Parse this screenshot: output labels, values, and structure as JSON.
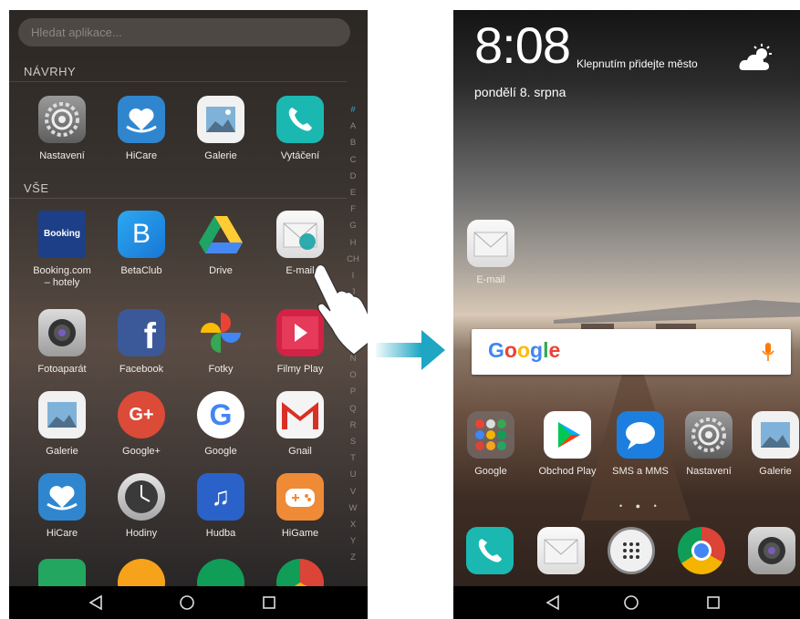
{
  "left_screen": {
    "search_placeholder": "Hledat aplikace...",
    "sections": {
      "suggestions": "NÁVRHY",
      "all": "VŠE"
    },
    "suggested_apps": [
      {
        "label": "Nastavení",
        "icon": "settings-icon"
      },
      {
        "label": "HiCare",
        "icon": "hicare-icon"
      },
      {
        "label": "Galerie",
        "icon": "gallery-icon"
      },
      {
        "label": "Vytáčení",
        "icon": "phone-icon"
      }
    ],
    "all_apps": [
      {
        "label": "Booking.com – hotely",
        "icon": "booking-icon",
        "icon_text": "Booking"
      },
      {
        "label": "BetaClub",
        "icon": "betaclub-icon",
        "icon_text": "B"
      },
      {
        "label": "Drive",
        "icon": "drive-icon"
      },
      {
        "label": "E-mail",
        "icon": "email-icon"
      },
      {
        "label": "Fotoaparát",
        "icon": "camera-icon"
      },
      {
        "label": "Facebook",
        "icon": "facebook-icon",
        "icon_text": "f"
      },
      {
        "label": "Fotky",
        "icon": "photos-icon"
      },
      {
        "label": "Filmy Play",
        "icon": "play-movies-icon"
      },
      {
        "label": "Galerie",
        "icon": "gallery-icon"
      },
      {
        "label": "Google+",
        "icon": "googleplus-icon",
        "icon_text": "G+"
      },
      {
        "label": "Google",
        "icon": "google-icon",
        "icon_text": "G"
      },
      {
        "label": "Gnail",
        "icon": "gmail-icon",
        "icon_text": "M"
      },
      {
        "label": "HiCare",
        "icon": "hicare-icon"
      },
      {
        "label": "Hodiny",
        "icon": "clock-icon"
      },
      {
        "label": "Hudba",
        "icon": "music-icon",
        "icon_text": "♫"
      },
      {
        "label": "HiGame",
        "icon": "game-icon"
      }
    ],
    "partial_row_icons": [
      "play-games-icon",
      "play-music-icon",
      "hangouts-icon",
      "chrome-icon"
    ],
    "alphabet_index": [
      "#",
      "A",
      "B",
      "C",
      "D",
      "E",
      "F",
      "G",
      "H",
      "CH",
      "I",
      "J",
      "K",
      "L",
      "M",
      "N",
      "O",
      "P",
      "Q",
      "R",
      "S",
      "T",
      "U",
      "V",
      "W",
      "X",
      "Y",
      "Z"
    ],
    "gesture": "tap-hand-icon"
  },
  "right_screen": {
    "time": "8:08",
    "city_hint": "Klepnutím přidejte město",
    "date": "pondělí 8. srpna",
    "weather_icon": "partly-cloudy-icon",
    "placed_app": {
      "label": "E-mail",
      "icon": "email-icon"
    },
    "search_widget": {
      "logo_text": "Google",
      "mic_icon": "microphone-icon"
    },
    "home_apps": [
      {
        "label": "Google",
        "icon": "google-folder-icon"
      },
      {
        "label": "Obchod Play",
        "icon": "play-store-icon"
      },
      {
        "label": "SMS a MMS",
        "icon": "sms-icon"
      },
      {
        "label": "Nastavení",
        "icon": "settings-icon"
      },
      {
        "label": "Galerie",
        "icon": "gallery-icon"
      }
    ],
    "dock_icons": [
      "phone-icon",
      "email-icon",
      "app-drawer-icon",
      "chrome-icon",
      "camera-icon"
    ]
  },
  "navbar": {
    "back_icon": "back-triangle-icon",
    "home_icon": "home-circle-icon",
    "recents_icon": "recents-square-icon"
  },
  "colors": {
    "accent_arrow": "#1ea6c4",
    "google_blue": "#4a78d8",
    "mic_orange": "#ff7a00"
  }
}
